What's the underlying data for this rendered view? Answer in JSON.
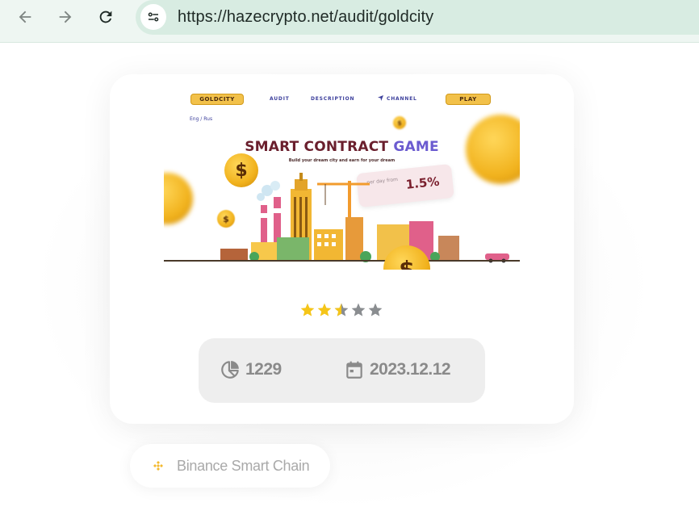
{
  "browser": {
    "url": "https://hazecrypto.net/audit/goldcity",
    "icons": [
      "back-arrow-icon",
      "forward-arrow-icon",
      "reload-icon",
      "site-settings-icon"
    ]
  },
  "hero": {
    "nav": {
      "logo_label": "GOLDCITY",
      "audit_label": "AUDIT",
      "description_label": "DESCRIPTION",
      "channel_label": "CHANNEL",
      "play_label": "PLAY"
    },
    "lang_label": "Eng / Rus",
    "title_main": "SMART CONTRACT ",
    "title_highlight": "GAME",
    "subtitle": "Build your dream city and earn for your dream",
    "rate_label": "per day from",
    "rate_value": "1.5%",
    "coin_symbol": "$"
  },
  "rating": {
    "value": 2.5,
    "max": 5,
    "colors": {
      "filled": "#f5c518",
      "empty": "#8a8d90"
    }
  },
  "stats": {
    "views": "1229",
    "date": "2023.12.12",
    "icons": [
      "pie-chart-icon",
      "calendar-icon"
    ]
  },
  "chain": {
    "name": "Binance Smart Chain",
    "icon": "binance-icon",
    "color": "#f3ba2f"
  }
}
